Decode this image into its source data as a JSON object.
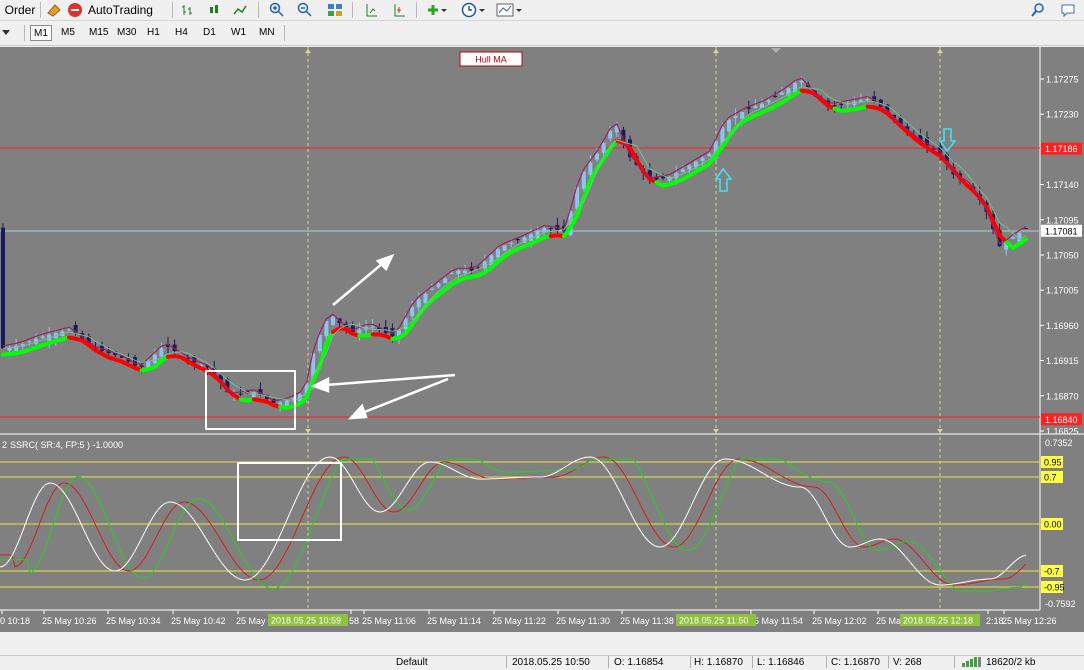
{
  "toolbar": {
    "order_label": "Order",
    "autotrading_label": "AutoTrading"
  },
  "timeframes": [
    "M1",
    "M5",
    "M15",
    "M30",
    "H1",
    "H4",
    "D1",
    "W1",
    "MN"
  ],
  "active_timeframe": "M1",
  "chart": {
    "indicator_label": "Hull MA",
    "price_axis": [
      "1.17275",
      "1.17230",
      "1.17186",
      "1.17140",
      "1.17095",
      "1.17081",
      "1.17050",
      "1.17005",
      "1.16960",
      "1.16915",
      "1.16870",
      "1.16840",
      "1.16825"
    ],
    "highlight_prices": [
      {
        "value": "1.17186",
        "color": "#ff2020"
      },
      {
        "value": "1.17081",
        "color": "#ffffff"
      },
      {
        "value": "1.16840",
        "color": "#ff2020"
      }
    ],
    "colors": {
      "bull_candle": "#87c6f0",
      "bear_candle": "#1a1a5a",
      "hull_up": "#00ff00",
      "hull_down": "#ff0000",
      "background": "#808080"
    }
  },
  "oscillator": {
    "title": "SSRC( SR:4, FP:5 ) -1.0000",
    "title_prefix": "2",
    "axis": [
      "0.7352",
      "0.00",
      "-0.7592"
    ],
    "levels": [
      "0.95",
      "0.7",
      "0.00",
      "-0.7",
      "-0.95"
    ]
  },
  "time_axis": {
    "labels": [
      "0 10:18",
      "25 May 10:26",
      "25 May 10:34",
      "25 May 10:42",
      "25 May",
      "58",
      "25 May 11:06",
      "25 May 11:14",
      "25 May 11:22",
      "25 May 11:30",
      "25 May 11:38",
      "25 May 11:54",
      "25 May 12:02",
      "25 Ma",
      "2:18",
      "25 May 12:26"
    ],
    "highlights": [
      "2018.05.25 10:59",
      "2018.05.25 11:50",
      "2018.05.25 12:18"
    ]
  },
  "status": {
    "profile": "Default",
    "datetime": "2018.05.25 10:50",
    "open": "O: 1.16854",
    "high": "H: 1.16870",
    "low": "L: 1.16846",
    "close": "C: 1.16870",
    "volume": "V: 268",
    "traffic": "18620/2 kb"
  }
}
